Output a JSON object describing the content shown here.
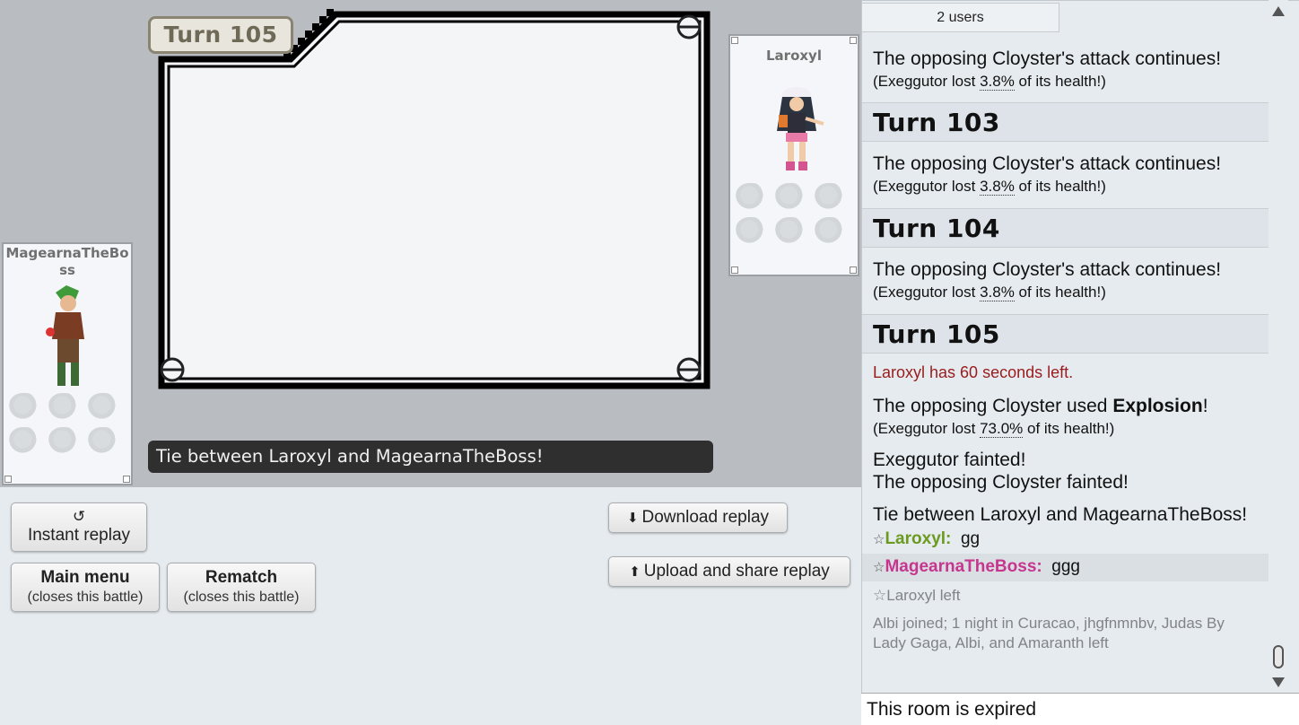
{
  "battle": {
    "turn_label": "Turn 105",
    "message": "Tie between Laroxyl and MagearnaTheBoss!",
    "left_player": "MagearnaTheBoss",
    "right_player": "Laroxyl"
  },
  "controls": {
    "instant_replay": "Instant replay",
    "main_menu": "Main menu",
    "main_menu_note": "(closes this battle)",
    "rematch": "Rematch",
    "rematch_note": "(closes this battle)",
    "download_replay": "Download replay",
    "upload_replay": "Upload and share replay"
  },
  "log": {
    "users_tab": "2 users",
    "entries": {
      "e1_line": "The opposing Cloyster's attack continues!",
      "e1_sub_pre": "(Exeggutor lost ",
      "e1_pct": "3.8%",
      "e1_sub_post": " of its health!)",
      "turn103": "Turn 103",
      "e2_line": "The opposing Cloyster's attack continues!",
      "e2_sub_pre": "(Exeggutor lost ",
      "e2_pct": "3.8%",
      "e2_sub_post": " of its health!)",
      "turn104": "Turn 104",
      "e3_line": "The opposing Cloyster's attack continues!",
      "e3_sub_pre": "(Exeggutor lost ",
      "e3_pct": "3.8%",
      "e3_sub_post": " of its health!)",
      "turn105": "Turn 105",
      "timer": "Laroxyl has 60 seconds left.",
      "explosion_pre": "The opposing Cloyster used ",
      "explosion_move": "Explosion",
      "explosion_post": "!",
      "e4_sub_pre": "(Exeggutor lost ",
      "e4_pct": "73.0%",
      "e4_sub_post": " of its health!)",
      "faint1": "Exeggutor fainted!",
      "faint2": "The opposing Cloyster fainted!",
      "tie": "Tie between Laroxyl and MagearnaTheBoss!",
      "chat1_star": "☆",
      "chat1_name": "Laroxyl:",
      "chat1_text": "gg",
      "chat2_star": "☆",
      "chat2_name": "MagearnaTheBoss:",
      "chat2_text": "ggg",
      "left_notice": "☆Laroxyl left",
      "join_notice": "Albi joined; 1 night in Curacao, jhgfnmnbv, Judas By Lady Gaga, Albi, and Amaranth left"
    }
  },
  "footer": {
    "expired": "This room is expired"
  },
  "colors": {
    "laroxyl": "#6b9a21",
    "magearna": "#c6358e",
    "timer": "#9a1c1c"
  }
}
